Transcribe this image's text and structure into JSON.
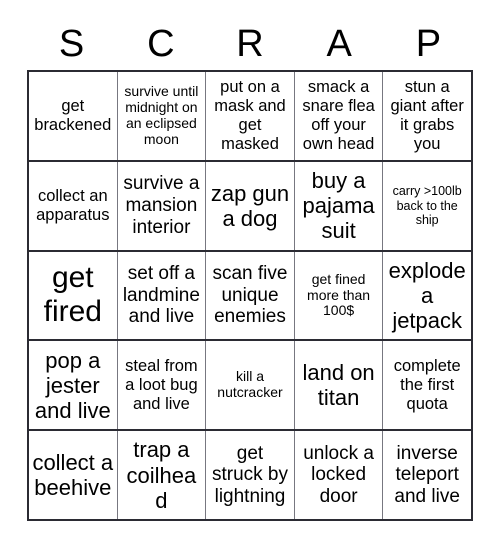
{
  "card": {
    "title_letters": [
      "S",
      "C",
      "R",
      "A",
      "P"
    ],
    "columns": 5,
    "rows": 5,
    "border_color": "#2b2b33",
    "inner_line_color": "#777780",
    "background_color": "#ffffff",
    "text_color": "#000000"
  },
  "cells": [
    [
      {
        "text": "get brackened",
        "size": "md"
      },
      {
        "text": "survive until midnight on an eclipsed moon",
        "size": "sm"
      },
      {
        "text": "put on a mask and get masked",
        "size": "md"
      },
      {
        "text": "smack a snare flea off your own head",
        "size": "md"
      },
      {
        "text": "stun a giant after it grabs you",
        "size": "md"
      }
    ],
    [
      {
        "text": "collect an apparatus",
        "size": "md"
      },
      {
        "text": "survive a mansion interior",
        "size": "lg"
      },
      {
        "text": "zap gun a dog",
        "size": "xl"
      },
      {
        "text": "buy a pajama suit",
        "size": "xl"
      },
      {
        "text": "carry >100lb back to the ship",
        "size": "xs"
      }
    ],
    [
      {
        "text": "get fired",
        "size": "xxl"
      },
      {
        "text": "set off a landmine and live",
        "size": "lg"
      },
      {
        "text": "scan five unique enemies",
        "size": "lg"
      },
      {
        "text": "get fined more than 100$",
        "size": "sm"
      },
      {
        "text": "explode a jetpack",
        "size": "xl"
      }
    ],
    [
      {
        "text": "pop a jester and live",
        "size": "xl"
      },
      {
        "text": "steal from a loot bug and live",
        "size": "md"
      },
      {
        "text": "kill a nutcracker",
        "size": "sm"
      },
      {
        "text": "land on titan",
        "size": "xl"
      },
      {
        "text": "complete the first quota",
        "size": "md"
      }
    ],
    [
      {
        "text": "collect a beehive",
        "size": "xl"
      },
      {
        "text": "trap a coilhead",
        "size": "xl"
      },
      {
        "text": "get struck by lightning",
        "size": "lg"
      },
      {
        "text": "unlock a locked door",
        "size": "lg"
      },
      {
        "text": "inverse teleport and live",
        "size": "lg"
      }
    ]
  ]
}
